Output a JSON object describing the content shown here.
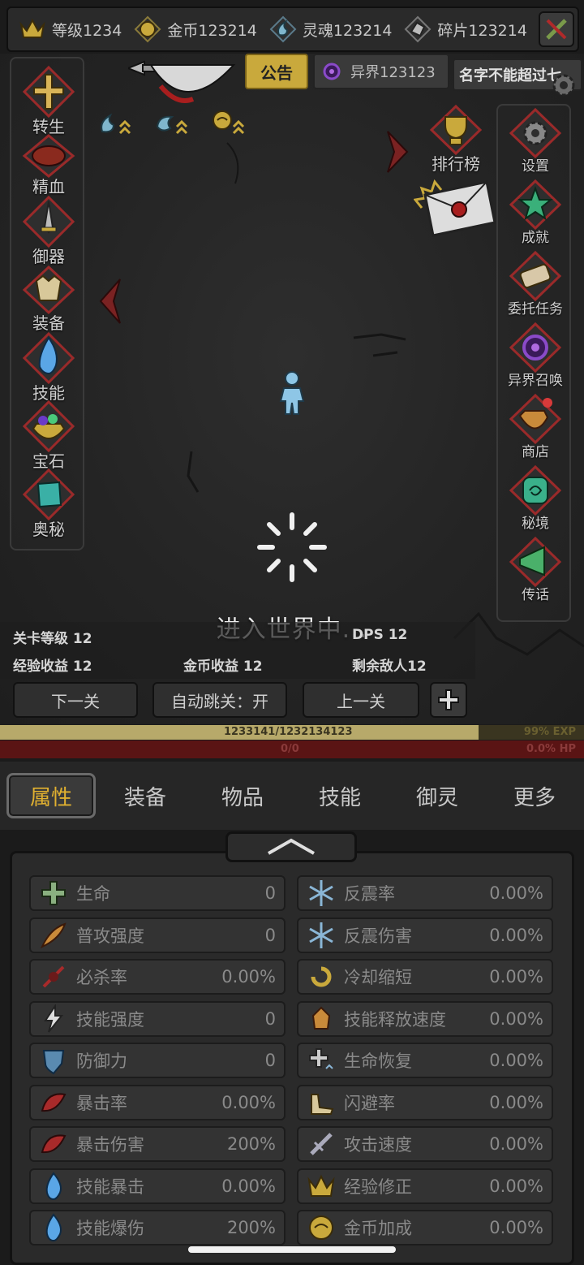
{
  "resources": [
    {
      "icon": "crown-icon",
      "label": "等级1234"
    },
    {
      "icon": "gold-coin-icon",
      "label": "金币123214"
    },
    {
      "icon": "soul-icon",
      "label": "灵魂123214"
    },
    {
      "icon": "fragment-icon",
      "label": "碎片123214"
    }
  ],
  "notice_label": "公告",
  "otherworld_label": "异界123123",
  "player_name": "名字不能超过七",
  "left_menu": [
    "转生",
    "精血",
    "御器",
    "装备",
    "技能",
    "宝石",
    "奥秘"
  ],
  "right_menu": [
    "设置",
    "成就",
    "委托任务",
    "异界召唤",
    "商店",
    "秘境",
    "传话"
  ],
  "leaderboard_label": "排行榜",
  "loading_text": "进入世界中...",
  "stats": {
    "stage_level": "关卡等级 12",
    "dps": "DPS 12",
    "exp_income": "经验收益 12",
    "gold_income": "金币收益 12",
    "enemies_left": "剩余敌人12"
  },
  "buttons": {
    "next": "下一关",
    "auto": "自动跳关：开",
    "prev": "上一关"
  },
  "exp": {
    "text": "1233141/1232134123",
    "percent_label": "99% EXP",
    "fraction": 0.82
  },
  "hp": {
    "text": "0/0",
    "percent_label": "0.0%  HP"
  },
  "tabs": [
    "属性",
    "装备",
    "物品",
    "技能",
    "御灵",
    "更多"
  ],
  "attributes_left": [
    {
      "name": "生命",
      "value": "0",
      "icon": "health-cross-icon"
    },
    {
      "name": "普攻强度",
      "value": "0",
      "icon": "attack-feather-icon"
    },
    {
      "name": "必杀率",
      "value": "0.00%",
      "icon": "kill-rate-icon"
    },
    {
      "name": "技能强度",
      "value": "0",
      "icon": "lightning-icon"
    },
    {
      "name": "防御力",
      "value": "0",
      "icon": "shield-icon"
    },
    {
      "name": "暴击率",
      "value": "0.00%",
      "icon": "crit-rate-icon"
    },
    {
      "name": "暴击伤害",
      "value": "200%",
      "icon": "crit-damage-icon"
    },
    {
      "name": "技能暴击",
      "value": "0.00%",
      "icon": "blue-flame-icon"
    },
    {
      "name": "技能爆伤",
      "value": "200%",
      "icon": "blue-flame-icon"
    }
  ],
  "attributes_right": [
    {
      "name": "反震率",
      "value": "0.00%",
      "icon": "snowflake-icon"
    },
    {
      "name": "反震伤害",
      "value": "0.00%",
      "icon": "snowflake-icon"
    },
    {
      "name": "冷却缩短",
      "value": "0.00%",
      "icon": "cooldown-icon"
    },
    {
      "name": "技能释放速度",
      "value": "0.00%",
      "icon": "cast-speed-icon"
    },
    {
      "name": "生命恢复",
      "value": "0.00%",
      "icon": "regen-icon"
    },
    {
      "name": "闪避率",
      "value": "0.00%",
      "icon": "dodge-boot-icon"
    },
    {
      "name": "攻击速度",
      "value": "0.00%",
      "icon": "attack-speed-icon"
    },
    {
      "name": "经验修正",
      "value": "0.00%",
      "icon": "crown-icon"
    },
    {
      "name": "金币加成",
      "value": "0.00%",
      "icon": "gold-coin-icon"
    }
  ]
}
